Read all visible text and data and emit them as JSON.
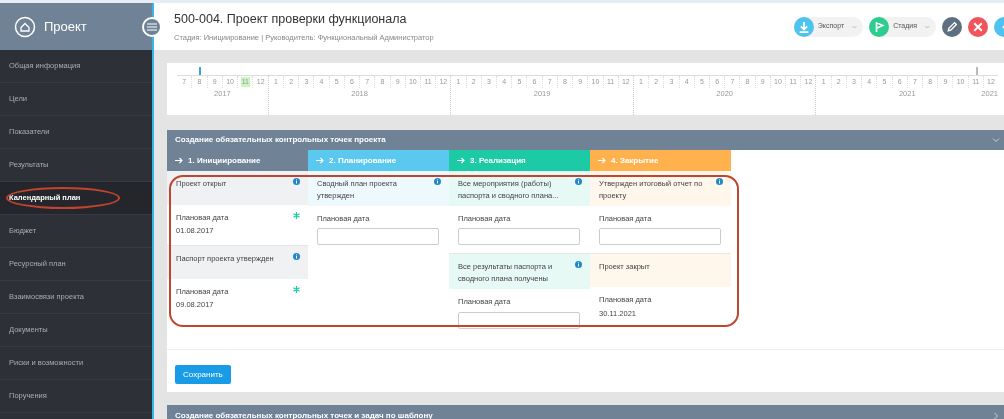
{
  "sidebar": {
    "title": "Проект",
    "items": [
      {
        "label": "Общая информация",
        "selected": false,
        "circled": false
      },
      {
        "label": "Цели",
        "selected": false,
        "circled": false
      },
      {
        "label": "Показатели",
        "selected": false,
        "circled": false
      },
      {
        "label": "Результаты",
        "selected": false,
        "circled": false
      },
      {
        "label": "Календарный план",
        "selected": true,
        "circled": true
      },
      {
        "label": "Бюджет",
        "selected": false,
        "circled": false
      },
      {
        "label": "Ресурсный план",
        "selected": false,
        "circled": false
      },
      {
        "label": "Взаимосвязи проекта",
        "selected": false,
        "circled": false
      },
      {
        "label": "Документы",
        "selected": false,
        "circled": false
      },
      {
        "label": "Риски и возможности",
        "selected": false,
        "circled": false
      },
      {
        "label": "Поручения",
        "selected": false,
        "circled": false
      }
    ]
  },
  "header": {
    "title": "500-004. Проект проверки функционала",
    "subtitle": "Стадия: Инициирование | Руководитель: Функциональный Администратор",
    "actions": [
      {
        "kind": "export",
        "label": "Экспорт",
        "color": "#4fc3f0"
      },
      {
        "kind": "stage",
        "label": "Стадия",
        "color": "#2ecc8f"
      },
      {
        "kind": "edit",
        "color": "#5e6f82"
      },
      {
        "kind": "delete",
        "color": "#f2545b"
      },
      {
        "kind": "more",
        "color": "#4fc3f0"
      }
    ]
  },
  "timeline": {
    "end_label": "2021",
    "years": [
      {
        "label": "2017",
        "months": [
          {
            "label": "7",
            "current": false
          },
          {
            "label": "8",
            "current": false,
            "marked": true,
            "color": "#35a6e0"
          },
          {
            "label": "9",
            "current": false
          },
          {
            "label": "10",
            "current": false
          },
          {
            "label": "11",
            "current": true
          },
          {
            "label": "12",
            "current": false
          }
        ]
      },
      {
        "label": "2018",
        "months": [
          {
            "label": "1",
            "current": false
          },
          {
            "label": "2",
            "current": false
          },
          {
            "label": "3",
            "current": false
          },
          {
            "label": "4",
            "current": false
          },
          {
            "label": "5",
            "current": false
          },
          {
            "label": "6",
            "current": false
          },
          {
            "label": "7",
            "current": false
          },
          {
            "label": "8",
            "current": false
          },
          {
            "label": "9",
            "current": false
          },
          {
            "label": "10",
            "current": false
          },
          {
            "label": "11",
            "current": false
          },
          {
            "label": "12",
            "current": false
          }
        ]
      },
      {
        "label": "2019",
        "months": [
          {
            "label": "1",
            "current": false
          },
          {
            "label": "2",
            "current": false
          },
          {
            "label": "3",
            "current": false
          },
          {
            "label": "4",
            "current": false
          },
          {
            "label": "5",
            "current": false
          },
          {
            "label": "6",
            "current": false
          },
          {
            "label": "7",
            "current": false
          },
          {
            "label": "8",
            "current": false
          },
          {
            "label": "9",
            "current": false
          },
          {
            "label": "10",
            "current": false
          },
          {
            "label": "11",
            "current": false
          },
          {
            "label": "12",
            "current": false
          }
        ]
      },
      {
        "label": "2020",
        "months": [
          {
            "label": "1",
            "current": false
          },
          {
            "label": "2",
            "current": false
          },
          {
            "label": "3",
            "current": false
          },
          {
            "label": "4",
            "current": false
          },
          {
            "label": "5",
            "current": false
          },
          {
            "label": "6",
            "current": false
          },
          {
            "label": "7",
            "current": false
          },
          {
            "label": "8",
            "current": false
          },
          {
            "label": "9",
            "current": false
          },
          {
            "label": "10",
            "current": false
          },
          {
            "label": "11",
            "current": false
          },
          {
            "label": "12",
            "current": false
          }
        ]
      },
      {
        "label": "2021",
        "months": [
          {
            "label": "1",
            "current": false
          },
          {
            "label": "2",
            "current": false
          },
          {
            "label": "3",
            "current": false
          },
          {
            "label": "4",
            "current": false
          },
          {
            "label": "5",
            "current": false
          },
          {
            "label": "6",
            "current": false
          },
          {
            "label": "7",
            "current": false
          },
          {
            "label": "8",
            "current": false
          },
          {
            "label": "9",
            "current": false
          },
          {
            "label": "10",
            "current": false
          },
          {
            "label": "11",
            "current": false,
            "marked": true,
            "color": "#bbbbbb"
          },
          {
            "label": "12",
            "current": false
          }
        ]
      }
    ]
  },
  "checkpoints": {
    "title": "Создание обязательных контрольных точек проекта",
    "expanded": true,
    "circled": true,
    "stages": [
      {
        "label": "1. Инициирование",
        "color": "#6f8296",
        "milestones": [
          {
            "title": "Проект открыт",
            "info": true,
            "date_label": "Плановая дата",
            "kind": "fixed",
            "date": "01.08.2017",
            "required": true
          },
          {
            "title": "Паспорт проекта утвержден",
            "info": true,
            "date_label": "Плановая дата",
            "kind": "fixed",
            "date": "09.08.2017",
            "required": true
          }
        ]
      },
      {
        "label": "2. Планирование",
        "color": "#5bc8f0",
        "milestones": [
          {
            "title": "Сводный план проекта утвержден",
            "info": true,
            "date_label": "Плановая дата",
            "kind": "input",
            "required": false
          }
        ]
      },
      {
        "label": "3. Реализация",
        "color": "#1ccaa6",
        "milestones": [
          {
            "title": "Все мероприятия (работы) паспорта и сводного плана...",
            "info": true,
            "date_label": "Плановая дата",
            "kind": "input",
            "required": false
          },
          {
            "title": "Все результаты паспорта и сводного плана получены",
            "info": true,
            "date_label": "Плановая дата",
            "kind": "input",
            "required": false
          }
        ]
      },
      {
        "label": "4. Закрытие",
        "color": "#ffb14e",
        "milestones": [
          {
            "title": "Утвержден итоговый отчет по проекту",
            "info": true,
            "date_label": "Плановая дата",
            "kind": "input",
            "required": false
          },
          {
            "title": "Проект закрыт",
            "info": false,
            "date_label": "Плановая дата",
            "kind": "fixed",
            "date": "30.11.2021",
            "required": false
          }
        ]
      }
    ],
    "save_label": "Сохранить"
  },
  "template_panel": {
    "title": "Создание обязательных контрольных точек и задач по шаблону",
    "expanded": false
  }
}
